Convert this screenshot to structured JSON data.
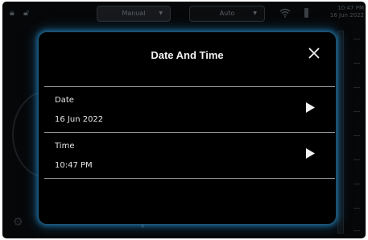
{
  "topbar": {
    "left_icons": [
      "lock-icon",
      "unlock-icon"
    ],
    "mode_select_1": "Manual",
    "mode_select_2": "Auto",
    "status_icons": [
      "wifi-icon",
      "battery-icon"
    ],
    "clock_time": "10:47 PM",
    "clock_date": "16 Jun 2022"
  },
  "modal": {
    "title": "Date And Time",
    "rows": [
      {
        "label": "Date",
        "value": "16 Jun 2022"
      },
      {
        "label": "Time",
        "value": "10:47 PM"
      }
    ]
  },
  "colors": {
    "modal_glow": "#2896d2",
    "background": "#060708",
    "divider": "#8d8f92"
  }
}
